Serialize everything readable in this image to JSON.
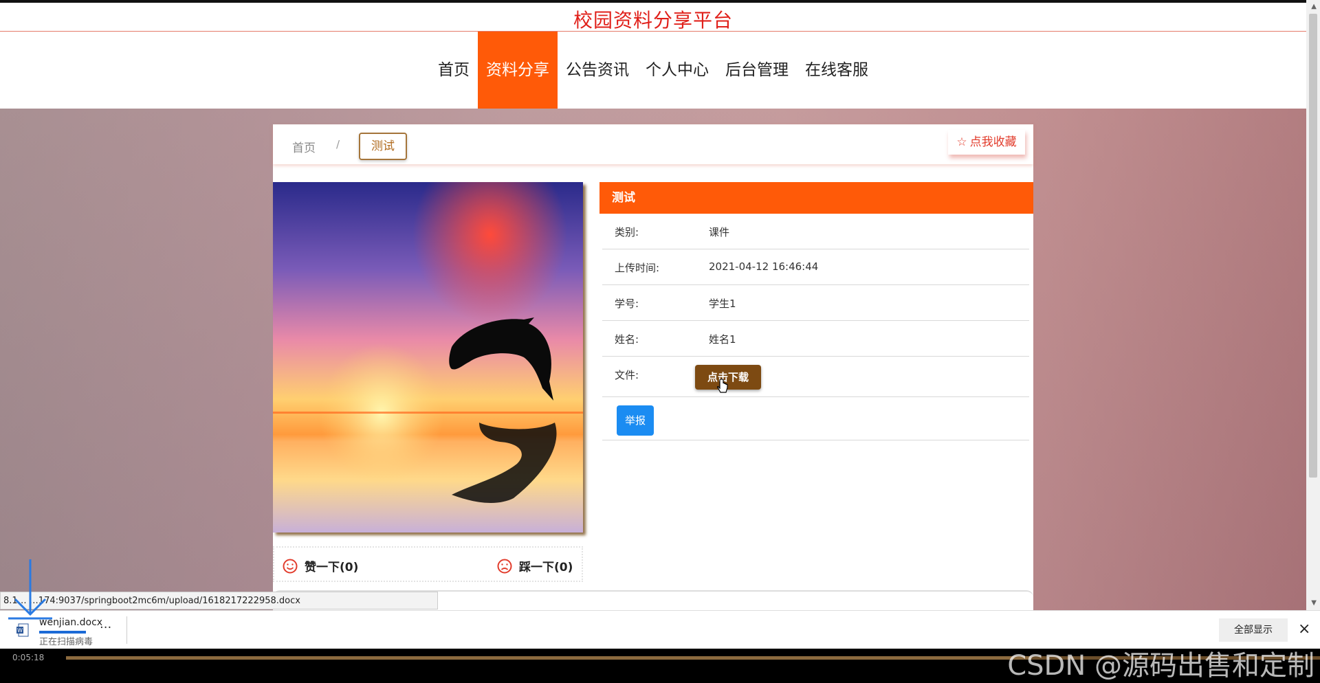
{
  "site": {
    "title": "校园资料分享平台"
  },
  "nav": {
    "items": [
      {
        "label": "首页",
        "active": false
      },
      {
        "label": "资料分享",
        "active": true
      },
      {
        "label": "公告资讯",
        "active": false
      },
      {
        "label": "个人中心",
        "active": false
      },
      {
        "label": "后台管理",
        "active": false
      },
      {
        "label": "在线客服",
        "active": false
      }
    ]
  },
  "breadcrumb": {
    "home": "首页",
    "separator": "/",
    "current": "测试"
  },
  "favorite": {
    "label": "点我收藏",
    "icon": "star-outline-icon"
  },
  "detail": {
    "title": "测试",
    "rows": [
      {
        "key": "类别:",
        "value": "课件"
      },
      {
        "key": "上传时间:",
        "value": "2021-04-12 16:46:44"
      },
      {
        "key": "学号:",
        "value": "学生1"
      },
      {
        "key": "姓名:",
        "value": "姓名1"
      }
    ],
    "file_label": "文件:",
    "download_label": "点击下载",
    "report_label": "举报"
  },
  "votes": {
    "like_label": "赞一下(0)",
    "dislike_label": "踩一下(0)"
  },
  "status_url": "8.1… …174:9037/springboot2mc6m/upload/1618217222958.docx",
  "download_bar": {
    "file_name": "wenjian.docx",
    "status": "正在扫描病毒",
    "more": "...",
    "show_all": "全部显示",
    "close": "×"
  },
  "video": {
    "time": "0:05:18",
    "played_fraction": 0.77
  },
  "watermark": "CSDN @源码出售和定制",
  "colors": {
    "brand_red": "#e0201a",
    "accent_orange": "#ff5a08",
    "download_brown": "#7d4a12",
    "report_blue": "#1b8cf2"
  }
}
